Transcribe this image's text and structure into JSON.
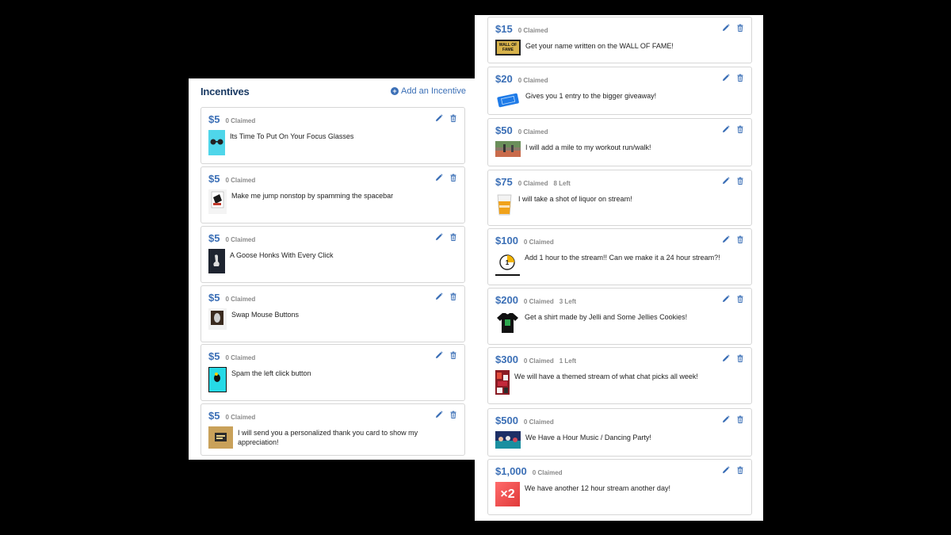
{
  "left_panel": {
    "title": "Incentives",
    "add_label": "Add an Incentive",
    "cards": [
      {
        "price": "$5",
        "claimed": "0 Claimed",
        "left": "",
        "description": "Its Time To Put On Your Focus Glasses",
        "image": "focus-glasses-image"
      },
      {
        "price": "$5",
        "claimed": "0 Claimed",
        "left": "",
        "description": "Make me jump nonstop by spamming the spacebar",
        "image": "jump-image"
      },
      {
        "price": "$5",
        "claimed": "0 Claimed",
        "left": "",
        "description": "A Goose Honks With Every Click",
        "image": "goose-image"
      },
      {
        "price": "$5",
        "claimed": "0 Claimed",
        "left": "",
        "description": "Swap Mouse Buttons",
        "image": "mouse-image"
      },
      {
        "price": "$5",
        "claimed": "0 Claimed",
        "left": "",
        "description": "Spam the left click button",
        "image": "click-image"
      },
      {
        "price": "$5",
        "claimed": "0 Claimed",
        "left": "",
        "description": "I will send you a personalized thank you card to show my appreciation!",
        "image": "thank-you-card-image"
      }
    ]
  },
  "right_panel": {
    "cards": [
      {
        "price": "$15",
        "claimed": "0 Claimed",
        "left": "",
        "description": "Get your name written on the WALL OF FAME!",
        "image": "wall-of-fame-image",
        "image_text": "WALL OF FAME"
      },
      {
        "price": "$20",
        "claimed": "0 Claimed",
        "left": "",
        "description": "Gives you 1 entry to the bigger giveaway!",
        "image": "ticket-image"
      },
      {
        "price": "$50",
        "claimed": "0 Claimed",
        "left": "",
        "description": "I will add a mile to my workout run/walk!",
        "image": "track-image"
      },
      {
        "price": "$75",
        "claimed": "0 Claimed",
        "left": "8 Left",
        "description": "I will take a shot of liquor on stream!",
        "image": "shot-glass-image"
      },
      {
        "price": "$100",
        "claimed": "0 Claimed",
        "left": "",
        "description": "Add 1 hour to the stream!! Can we make it a 24 hour stream?!",
        "image": "clock-image"
      },
      {
        "price": "$200",
        "claimed": "0 Claimed",
        "left": "3 Left",
        "description": "Get a shirt made by Jelli and Some Jellies Cookies!",
        "image": "shirt-image"
      },
      {
        "price": "$300",
        "claimed": "0 Claimed",
        "left": "1 Left",
        "description": "We will have a themed stream of what chat picks all week!",
        "image": "themed-stream-image"
      },
      {
        "price": "$500",
        "claimed": "0 Claimed",
        "left": "",
        "description": "We Have a Hour Music / Dancing Party!",
        "image": "dance-party-image"
      },
      {
        "price": "$1,000",
        "claimed": "0 Claimed",
        "left": "",
        "description": "We have another 12 hour stream another day!",
        "image": "x2-image",
        "image_text": "×2"
      }
    ]
  },
  "colors": {
    "accent": "#3b6fb6",
    "title": "#1a3a63",
    "muted": "#8a8a8a",
    "border": "#d6d6d6"
  },
  "icons": {
    "edit": "pencil-icon",
    "delete": "trash-icon",
    "add": "plus-circle-icon"
  }
}
